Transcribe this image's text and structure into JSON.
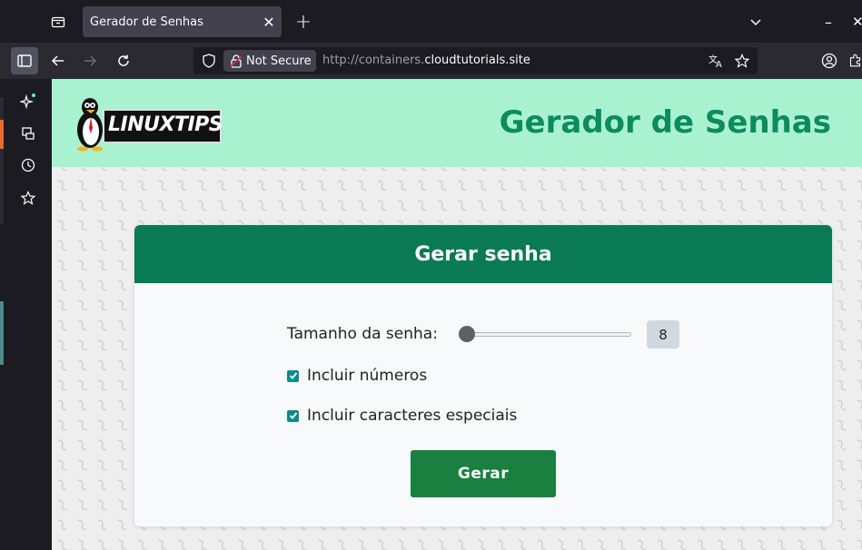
{
  "browser": {
    "tab": {
      "title": "Gerador de Senhas"
    },
    "urlbar": {
      "security_label": "Not Secure",
      "url_prefix": "http://containers.",
      "url_domain": "cloudtutorials.site"
    }
  },
  "site": {
    "logo_text": "LINUXTIPS",
    "title": "Gerador de Senhas"
  },
  "card": {
    "title": "Gerar senha",
    "length_label": "Tamanho da senha:",
    "length_value": "8",
    "length_fraction": 0.0,
    "include_numbers_label": "Incluir números",
    "include_numbers_checked": true,
    "include_special_label": "Incluir caracteres especiais",
    "include_special_checked": true,
    "generate_label": "Gerar"
  },
  "colors": {
    "header_bg": "#a8f2d0",
    "title_green": "#0e8a5f",
    "card_header": "#0a7a55",
    "button": "#19803f",
    "checkbox": "#108a8a"
  }
}
